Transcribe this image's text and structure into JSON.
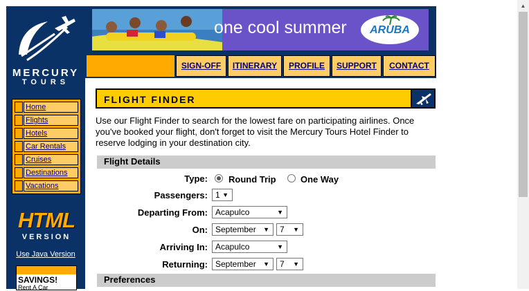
{
  "brand": {
    "line1": "MERCURY",
    "line2": "TOURS"
  },
  "side_nav": [
    {
      "label": "Home"
    },
    {
      "label": "Flights"
    },
    {
      "label": "Hotels"
    },
    {
      "label": "Car Rentals"
    },
    {
      "label": "Cruises"
    },
    {
      "label": "Destinations"
    },
    {
      "label": "Vacations"
    }
  ],
  "html_version": {
    "big": "HTML",
    "small": "VERSION",
    "java_link": "Use Java Version"
  },
  "promo": {
    "title": "SAVINGS!",
    "sub": "Rent A Car"
  },
  "banner": {
    "text": "one cool summer",
    "logo": "ARUBA"
  },
  "top_nav": [
    {
      "label": "SIGN-OFF"
    },
    {
      "label": "ITINERARY"
    },
    {
      "label": "PROFILE"
    },
    {
      "label": "SUPPORT"
    },
    {
      "label": "CONTACT"
    }
  ],
  "page": {
    "title": "FLIGHT FINDER",
    "intro": "Use our Flight Finder to search for the lowest fare on participating airlines. Once you've booked your flight, don't forget to visit the Mercury Tours Hotel Finder to reserve lodging in your destination city."
  },
  "form": {
    "section_flight": "Flight Details",
    "type_label": "Type:",
    "type_round": "Round Trip",
    "type_oneway": "One Way",
    "type_selected": "Round Trip",
    "passengers_label": "Passengers:",
    "passengers_value": "1",
    "departing_label": "Departing From:",
    "departing_value": "Acapulco",
    "on_label": "On:",
    "on_month": "September",
    "on_day": "7",
    "arriving_label": "Arriving In:",
    "arriving_value": "Acapulco",
    "returning_label": "Returning:",
    "return_month": "September",
    "return_day": "7",
    "section_prefs": "Preferences"
  },
  "colors": {
    "navy": "#0a3266",
    "orange": "#ffaa00",
    "light_orange": "#ffcc66",
    "yellow": "#ffcc00",
    "banner": "#6a52c8",
    "link": "#000080"
  }
}
